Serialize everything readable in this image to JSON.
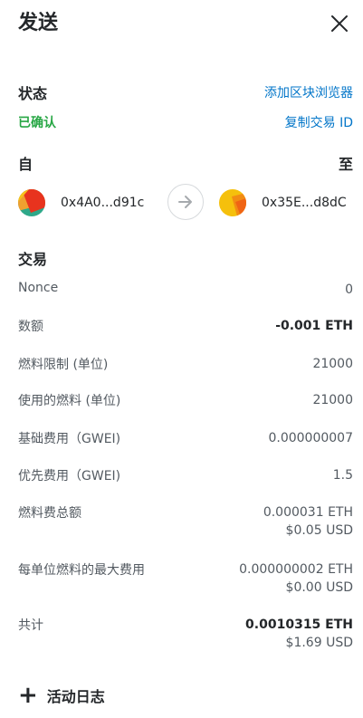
{
  "header": {
    "title": "发送"
  },
  "status": {
    "heading": "状态",
    "explorer_link": "添加区块浏览器",
    "confirmed": "已确认",
    "copy_tx_id": "复制交易 ID"
  },
  "parties": {
    "from_label": "自",
    "to_label": "至",
    "from_address": "0x4A0...d91c",
    "to_address": "0x35E...d8dC"
  },
  "transaction": {
    "heading": "交易",
    "rows": [
      {
        "label": "Nonce",
        "value": "0",
        "sub": ""
      },
      {
        "label": "数额",
        "value": "-0.001 ETH",
        "sub": ""
      },
      {
        "label": "燃料限制 (单位)",
        "value": "21000",
        "sub": ""
      },
      {
        "label": "使用的燃料 (单位)",
        "value": "21000",
        "sub": ""
      },
      {
        "label": "基础费用（GWEI)",
        "value": "0.000000007",
        "sub": ""
      },
      {
        "label": "优先费用（GWEI)",
        "value": "1.5",
        "sub": ""
      },
      {
        "label": "燃料费总额",
        "value": "0.000031 ETH",
        "sub": "$0.05 USD"
      },
      {
        "label": "每单位燃料的最大费用",
        "value": "0.000000002 ETH",
        "sub": "$0.00 USD"
      },
      {
        "label": "共计",
        "value": "0.0010315 ETH",
        "sub": "$1.69 USD"
      }
    ]
  },
  "activity": {
    "label": "活动日志"
  },
  "colors": {
    "link": "#0376c9",
    "success": "#28a745",
    "text": "#24272a",
    "muted": "#535a61"
  },
  "icons": {
    "close": "close-icon",
    "arrow": "arrow-right-icon",
    "plus": "plus-icon"
  }
}
